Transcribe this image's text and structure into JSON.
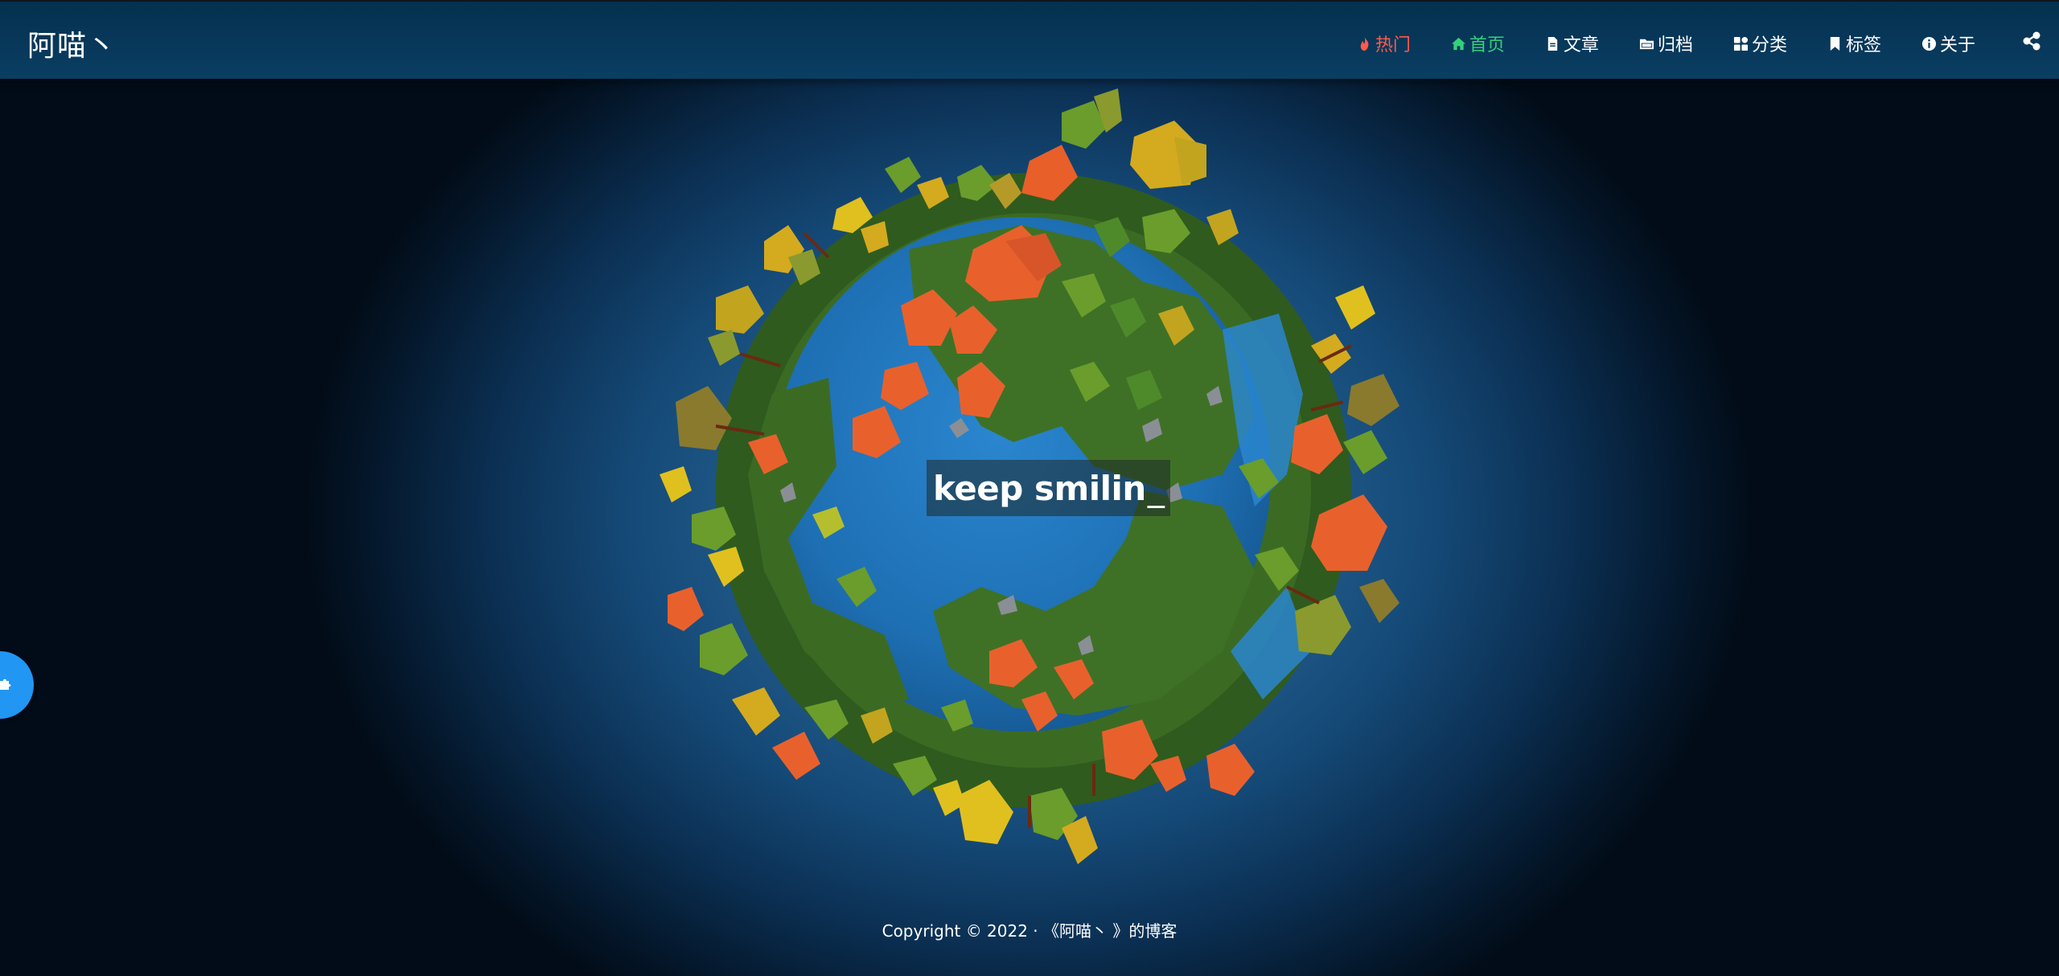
{
  "brand": {
    "title": "阿喵丶"
  },
  "nav": {
    "items": [
      {
        "label": "热门",
        "icon": "fire-icon",
        "state": "hot"
      },
      {
        "label": "首页",
        "icon": "home-icon",
        "state": "active"
      },
      {
        "label": "文章",
        "icon": "file-icon",
        "state": "normal"
      },
      {
        "label": "归档",
        "icon": "folder-icon",
        "state": "normal"
      },
      {
        "label": "分类",
        "icon": "grid-icon",
        "state": "normal"
      },
      {
        "label": "标签",
        "icon": "bookmark-icon",
        "state": "normal"
      },
      {
        "label": "关于",
        "icon": "info-icon",
        "state": "normal"
      }
    ],
    "share_icon": "share-icon"
  },
  "hero": {
    "typed_text": "keep smilin",
    "cursor": "_"
  },
  "footer": {
    "copyright": "Copyright © 2022 · 《阿喵丶 》的博客"
  },
  "side_button": {
    "icon": "puzzle-icon",
    "color": "#2196f3"
  },
  "colors": {
    "nav_bg": "#05304f",
    "hot": "#ff5a4a",
    "active": "#33d17a",
    "ocean": "#1e73b8",
    "land": "#3b6b23"
  }
}
